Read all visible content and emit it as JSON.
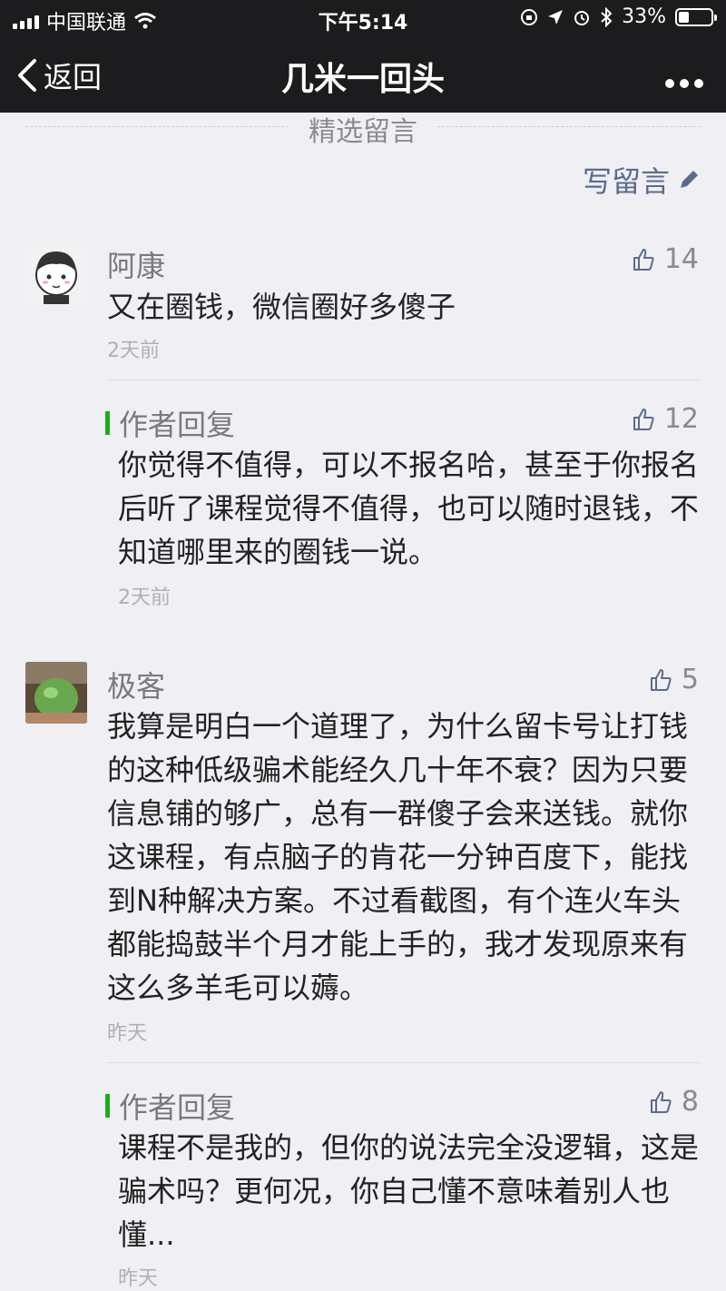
{
  "status_bar": {
    "carrier": "中国联通",
    "time": "下午5:14",
    "battery": "33%",
    "battery_level": 0.33
  },
  "nav": {
    "back_label": "返回",
    "title": "几米一回头"
  },
  "section": {
    "title": "精选留言",
    "write_label": "写留言"
  },
  "comments": [
    {
      "name": "阿康",
      "likes": "14",
      "text": "又在圈钱，微信圈好多傻子",
      "time": "2天前",
      "reply": {
        "label": "作者回复",
        "likes": "12",
        "text": "你觉得不值得，可以不报名哈，甚至于你报名后听了课程觉得不值得，也可以随时退钱，不知道哪里来的圈钱一说。",
        "time": "2天前"
      }
    },
    {
      "name": "极客",
      "likes": "5",
      "text": "我算是明白一个道理了，为什么留卡号让打钱的这种低级骗术能经久几十年不衰？因为只要信息铺的够广，总有一群傻子会来送钱。就你这课程，有点脑子的肯花一分钟百度下，能找到N种解决方案。不过看截图，有个连火车头都能捣鼓半个月才能上手的，我才发现原来有这么多羊毛可以薅。",
      "time": "昨天",
      "reply": {
        "label": "作者回复",
        "likes": "8",
        "text": "课程不是我的，但你的说法完全没逻辑，这是骗术吗？更何况，你自己懂不意味着别人也懂...",
        "time": "昨天"
      }
    }
  ],
  "colors": {
    "background": "#efeff4",
    "nav_background": "#1c1c1e",
    "link": "#5b6b8d",
    "reply_bar": "#1aad19"
  }
}
